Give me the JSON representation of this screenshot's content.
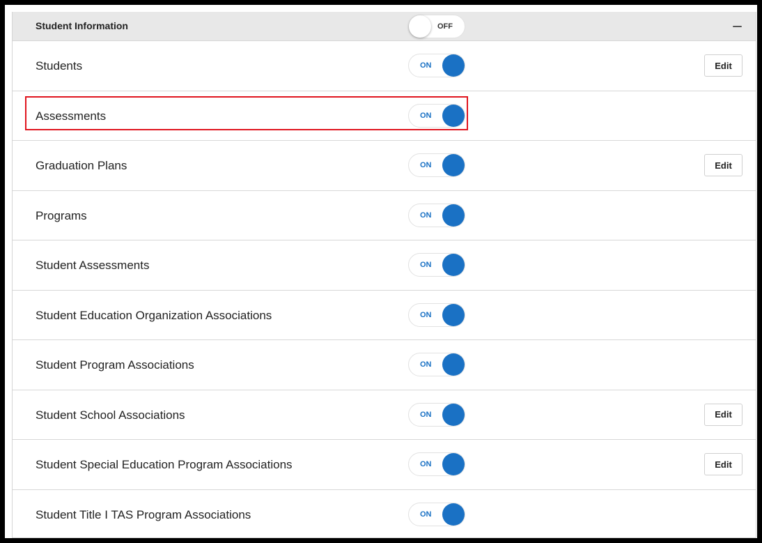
{
  "section": {
    "title": "Student Information",
    "toggle_state": "OFF",
    "collapse_icon": "minus-icon"
  },
  "rows": [
    {
      "label": "Students",
      "state": "ON",
      "edit": "Edit"
    },
    {
      "label": "Assessments",
      "state": "ON",
      "edit": null
    },
    {
      "label": "Graduation Plans",
      "state": "ON",
      "edit": "Edit"
    },
    {
      "label": "Programs",
      "state": "ON",
      "edit": null
    },
    {
      "label": "Student Assessments",
      "state": "ON",
      "edit": null
    },
    {
      "label": "Student Education Organization Associations",
      "state": "ON",
      "edit": null
    },
    {
      "label": "Student Program Associations",
      "state": "ON",
      "edit": null
    },
    {
      "label": "Student School Associations",
      "state": "ON",
      "edit": "Edit"
    },
    {
      "label": "Student Special Education Program Associations",
      "state": "ON",
      "edit": "Edit"
    },
    {
      "label": "Student Title I TAS Program Associations",
      "state": "ON",
      "edit": null
    }
  ],
  "colors": {
    "toggle_on": "#1a71c4",
    "highlight": "#e0141e",
    "header_bg": "#e8e8e8"
  }
}
